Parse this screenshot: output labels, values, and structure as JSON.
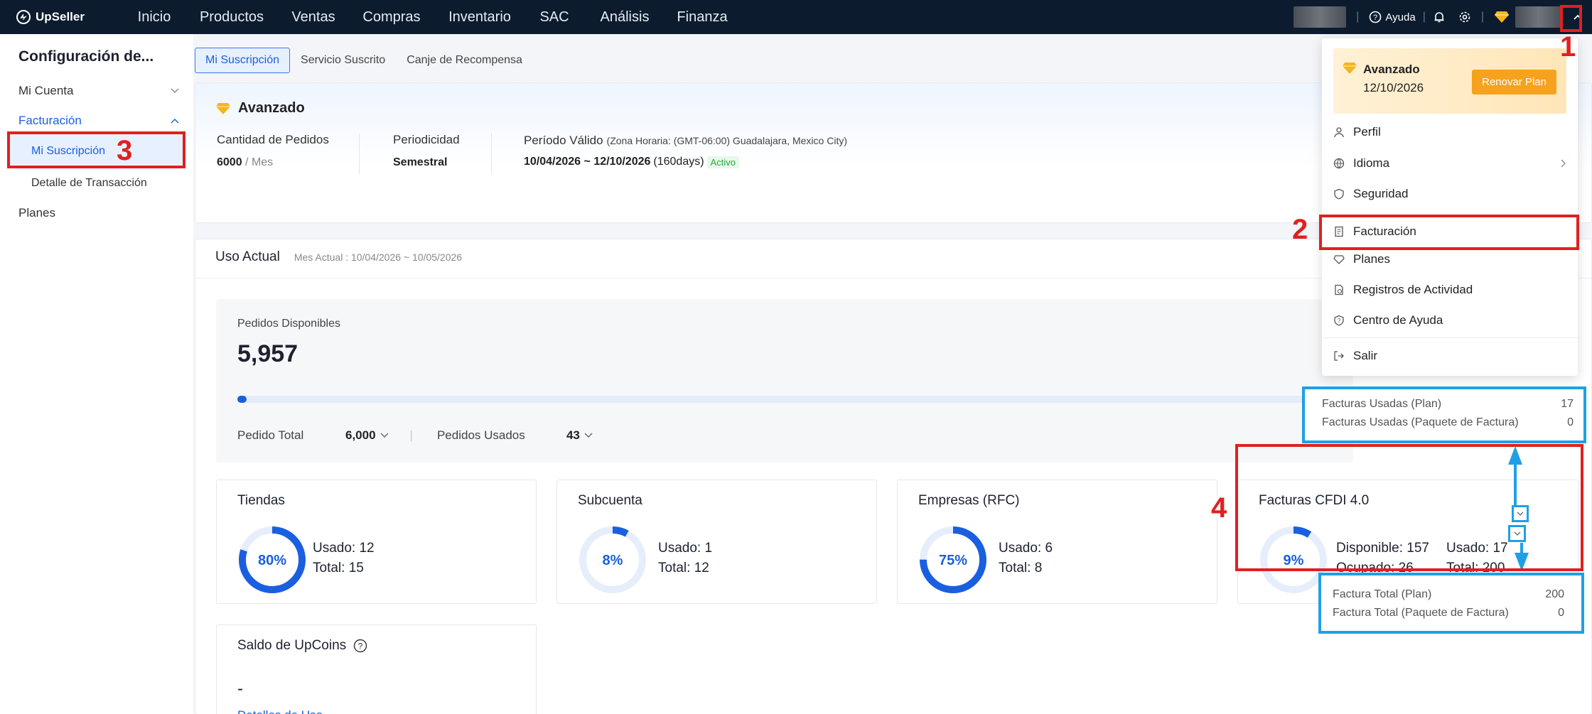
{
  "app": {
    "name": "UpSeller"
  },
  "nav": [
    "Inicio",
    "Productos",
    "Ventas",
    "Compras",
    "Inventario",
    "SAC",
    "Análisis",
    "Finanza"
  ],
  "topbar": {
    "help": "Ayuda"
  },
  "sidebar": {
    "title": "Configuración de...",
    "items": [
      "Mi Cuenta",
      "Facturación",
      "Mi Suscripción",
      "Detalle de Transacción",
      "Planes"
    ]
  },
  "tabs": [
    "Mi Suscripción",
    "Servicio Suscrito",
    "Canje de Recompensa"
  ],
  "plan": {
    "name": "Avanzado",
    "orders_label": "Cantidad de Pedidos",
    "orders_value": "6000",
    "orders_unit": "/ Mes",
    "period_label": "Periodicidad",
    "period_value": "Semestral",
    "valid_label": "Período Válido",
    "timezone": "(Zona Horaria: (GMT-06:00) Guadalajara, Mexico City)",
    "valid_range": "10/04/2026 ~ 12/10/2026",
    "valid_days": "(160days)",
    "status": "Activo"
  },
  "usage": {
    "title": "Uso Actual",
    "month": "Mes Actual : 10/04/2026 ~ 10/05/2026",
    "available_label": "Pedidos Disponibles",
    "available_value": "5,957",
    "progress": 0.007,
    "total_label": "Pedido Total",
    "total_value": "6,000",
    "used_label": "Pedidos Usados",
    "used_value": "43"
  },
  "stats": [
    {
      "title": "Tiendas",
      "pct": "80%",
      "pct_num": 80,
      "line1": "Usado: 12",
      "line2": "Total: 15"
    },
    {
      "title": "Subcuenta",
      "pct": "8%",
      "pct_num": 8,
      "line1": "Usado: 1",
      "line2": "Total: 12"
    },
    {
      "title": "Empresas (RFC)",
      "pct": "75%",
      "pct_num": 75,
      "line1": "Usado: 6",
      "line2": "Total: 8"
    },
    {
      "title": "Facturas CFDI 4.0",
      "pct": "9%",
      "pct_num": 9,
      "line1": "Disponible: 157",
      "line2": "Ocupado: 26",
      "line3": "Usado: 17",
      "line4": "Total: 200"
    }
  ],
  "upcoins": {
    "title": "Saldo de UpCoins",
    "value": "-",
    "link": "Detalles de Uso"
  },
  "menu": {
    "plan": "Avanzado",
    "date": "12/10/2026",
    "renew": "Renovar Plan",
    "items": [
      "Perfil",
      "Idioma",
      "Seguridad",
      "Facturación",
      "Planes",
      "Registros de Actividad",
      "Centro de Ayuda",
      "Salir"
    ]
  },
  "tooltip_used": [
    {
      "label": "Facturas Usadas (Plan)",
      "value": "17"
    },
    {
      "label": "Facturas Usadas (Paquete de Factura)",
      "value": "0"
    }
  ],
  "tooltip_total": [
    {
      "label": "Factura Total (Plan)",
      "value": "200"
    },
    {
      "label": "Factura Total (Paquete de Factura)",
      "value": "0"
    }
  ],
  "annotations": [
    "1",
    "2",
    "3",
    "4"
  ],
  "colors": {
    "accent": "#1a5fe0",
    "annotation_red": "#e02020",
    "annotation_blue": "#1fa0e6",
    "gold": "#f6a21e"
  }
}
